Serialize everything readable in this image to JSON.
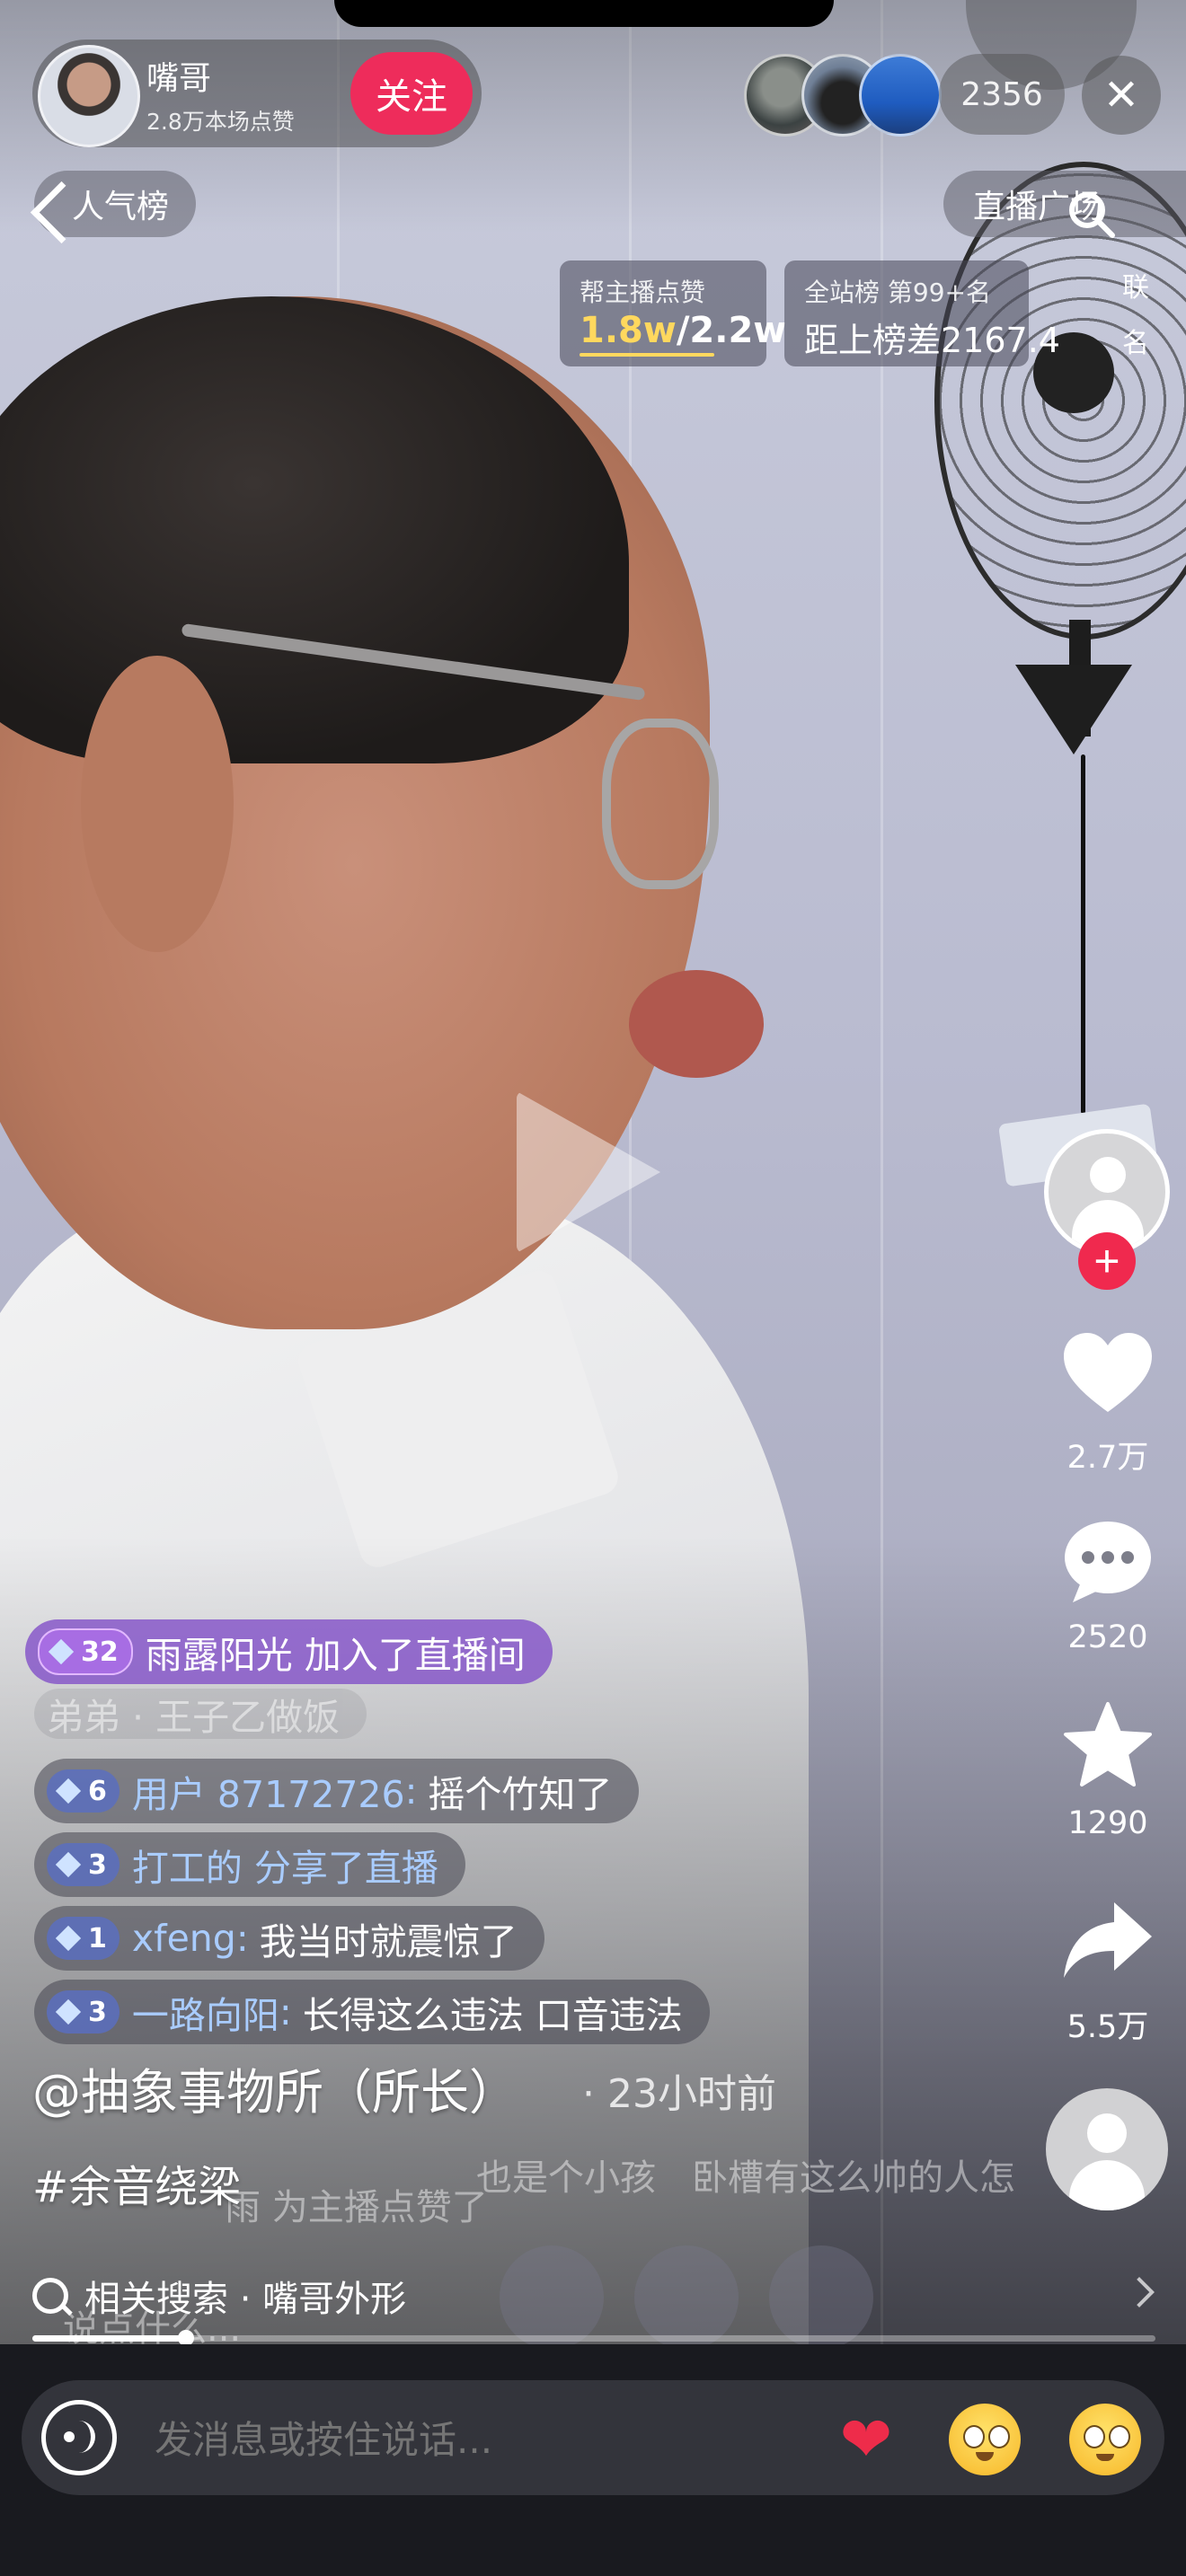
{
  "host": {
    "name": "嘴哥",
    "likes_text": "2.8万本场点赞",
    "follow_label": "关注"
  },
  "viewers": {
    "count": "2356"
  },
  "close_label": "✕",
  "nav": {
    "rank_label": "人气榜",
    "plaza_label": "直播广场",
    "side_tag": [
      "联",
      "名"
    ]
  },
  "stats": {
    "like_card_label": "帮主播点赞",
    "like_current": "1.8w",
    "like_sep": "/",
    "like_target": "2.2w",
    "rank_card_label": "全站榜 第99+名",
    "rank_gap": "距上榜差2167.4"
  },
  "actions": {
    "like_count": "2.7万",
    "comment_count": "2520",
    "favorite_count": "1290",
    "share_count": "5.5万",
    "follow_plus": "+"
  },
  "comments": {
    "join": {
      "level": "32",
      "text": "雨露阳光 加入了直播间"
    },
    "faded_top": "弟弟 · 王子乙做饭",
    "rows": [
      {
        "level": "6",
        "user": "用户 87172726",
        "sep": ":",
        "text": "摇个竹知了"
      },
      {
        "level": "3",
        "user": "打工的 分享了直播",
        "sep": "",
        "text": ""
      },
      {
        "level": "1",
        "user": "xfeng",
        "sep": ":",
        "text": "我当时就震惊了"
      },
      {
        "level": "3",
        "user": "一路向阳",
        "sep": ":",
        "text": "长得这么违法 口音违法"
      }
    ],
    "ghost_lines": [
      "卧槽有这么帅的人怎",
      "也是个小孩",
      "雨 为主播点赞了"
    ]
  },
  "post": {
    "author": "@抽象事物所（所长）",
    "time_ago": "· 23小时前",
    "hashtag": "#余音绕梁",
    "related_label": "相关搜索 · 嘴哥外形",
    "ghost_input": "说点什么..."
  },
  "progress": {
    "fraction": 0.137
  },
  "input": {
    "placeholder": "发消息或按住说话...",
    "heart": "❤"
  },
  "colors": {
    "accent": "#ee2c5b",
    "plus_badge": "#f0294e",
    "stat_highlight": "#ffd85e",
    "username": "#a9ccff"
  },
  "icons": [
    "search-icon",
    "heart-icon",
    "comment-icon",
    "star-icon",
    "share-icon",
    "voice-icon",
    "close-icon",
    "chevron-left-icon",
    "play-icon"
  ]
}
